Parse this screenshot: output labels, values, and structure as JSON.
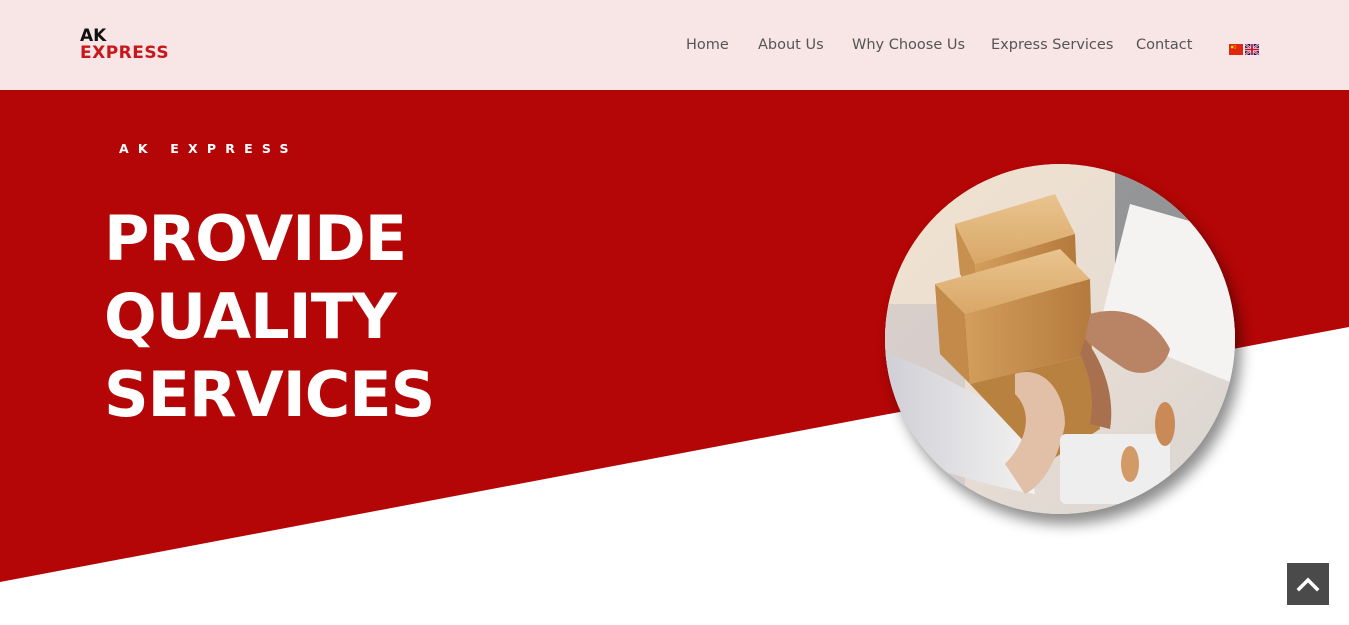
{
  "header": {
    "logo": {
      "line1": "AK",
      "line2": "EXPRESS"
    },
    "nav": {
      "home": "Home",
      "about": "About Us",
      "why": "Why Choose Us",
      "express": "Express Services",
      "contact": "Contact"
    },
    "languages": [
      {
        "icon": "china-flag-icon"
      },
      {
        "icon": "uk-flag-icon"
      }
    ]
  },
  "hero": {
    "kicker": "AK EXPRESS",
    "title_lines": [
      "PROVIDE",
      "QUALITY",
      "SERVICES"
    ],
    "image_icon": "package-handover-photo"
  },
  "back_to_top": {
    "icon": "chevron-up-icon"
  },
  "colors": {
    "header_bg": "#f8e5e5",
    "brand_red": "#b40606",
    "logo_red": "#c8161d",
    "nav_text": "#555555",
    "back_to_top_bg": "#4a4a4a"
  }
}
